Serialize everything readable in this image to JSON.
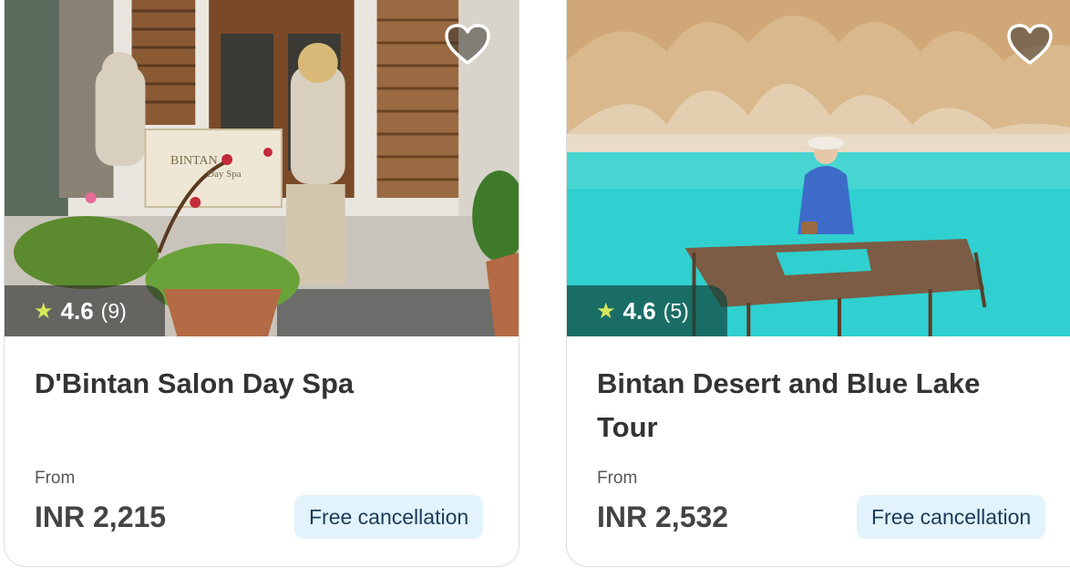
{
  "cards": [
    {
      "title": "D'Bintan Salon Day Spa",
      "rating": "4.6",
      "reviews": "(9)",
      "from_label": "From",
      "price": "INR 2,215",
      "badge": "Free cancellation",
      "sign_text": "BINTAN",
      "sign_sub": "Day Spa",
      "heart_icon": "heart-outline-icon",
      "star_icon": "star-icon"
    },
    {
      "title": "Bintan Desert and Blue Lake Tour",
      "rating": "4.6",
      "reviews": "(5)",
      "from_label": "From",
      "price": "INR 2,532",
      "badge": "Free cancellation",
      "heart_icon": "heart-outline-icon",
      "star_icon": "star-icon"
    }
  ],
  "colors": {
    "badge_bg": "#e2f3fb",
    "star": "#d6e85a",
    "lake": "#2fd0cf"
  }
}
